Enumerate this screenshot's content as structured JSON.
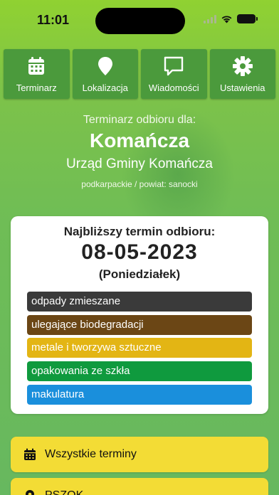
{
  "status_bar": {
    "time": "11:01"
  },
  "nav": {
    "items": [
      {
        "label": "Terminarz",
        "icon": "calendar-icon"
      },
      {
        "label": "Lokalizacja",
        "icon": "map-pin-icon"
      },
      {
        "label": "Wiadomości",
        "icon": "message-icon"
      },
      {
        "label": "Ustawienia",
        "icon": "gear-icon"
      }
    ]
  },
  "header": {
    "subtitle": "Terminarz odbioru dla:",
    "city": "Komańcza",
    "office": "Urząd Gminy Komańcza",
    "region": "podkarpackie / powiat: sanocki"
  },
  "next_pickup": {
    "title": "Najbliższy termin odbioru:",
    "date": "08-05-2023",
    "weekday": "(Poniedziałek)",
    "waste_types": [
      {
        "label": "odpady zmieszane",
        "color": "#3a3a3a"
      },
      {
        "label": "ulegające biodegradacji",
        "color": "#6b4615"
      },
      {
        "label": "metale i tworzywa sztuczne",
        "color": "#e3b514"
      },
      {
        "label": "opakowania ze szkła",
        "color": "#0f9a3e"
      },
      {
        "label": "makulatura",
        "color": "#1a8fdc"
      }
    ]
  },
  "actions": {
    "all_dates": "Wszystkie terminy",
    "pszok": "PSZOK"
  },
  "colors": {
    "nav_button": "#4b9a3c",
    "action_button": "#f3dc35"
  }
}
